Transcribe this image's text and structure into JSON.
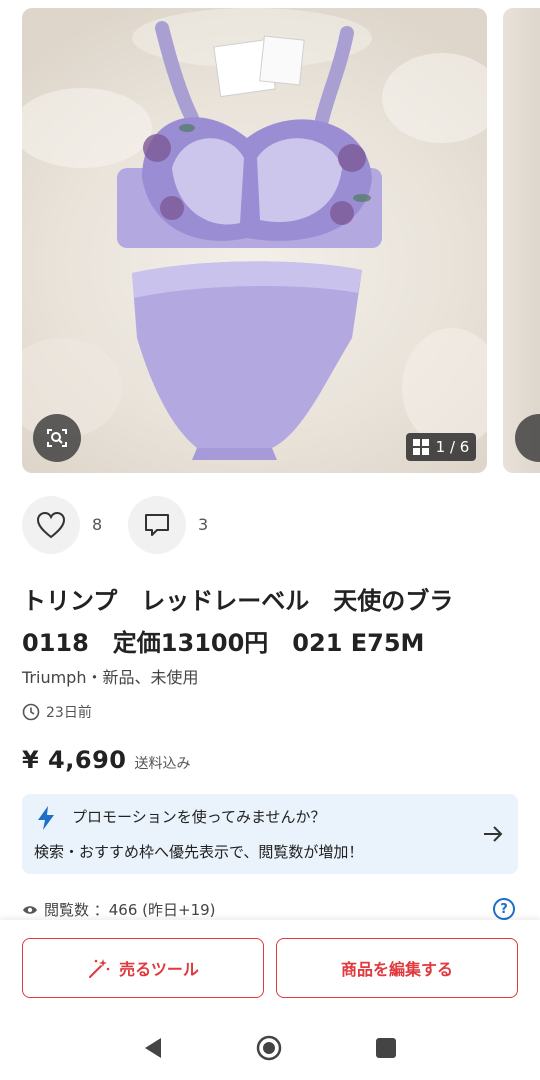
{
  "gallery": {
    "counter": "1 / 6"
  },
  "actions": {
    "likes_count": "8",
    "comments_count": "3"
  },
  "item": {
    "title_line1": "トリンプ　レッドレーベル　天使のブラ",
    "title_line2": "0118　定価13100円　021 E75M",
    "brand_condition": "Triumph・新品、未使用",
    "posted": "23日前",
    "price": "¥ 4,690",
    "price_note": "送料込み"
  },
  "promotion": {
    "title": "プロモーションを使ってみませんか？",
    "subtitle": "検索・おすすめ枠へ優先表示で、閲覧数が増加！"
  },
  "stats": {
    "views_label": "閲覧数 ：466 (昨日+19)"
  },
  "bottom": {
    "sell_tools_label": "売るツール",
    "edit_label": "商品を編集する"
  },
  "colors": {
    "accent_red": "#e0393e",
    "promo_bg": "#eaf3fb",
    "link_blue": "#1e6fc8"
  }
}
